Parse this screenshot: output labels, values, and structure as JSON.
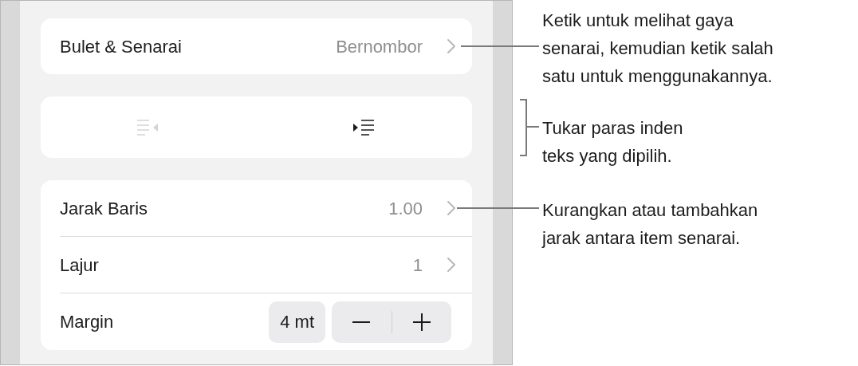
{
  "list_style_row": {
    "label": "Bulet & Senarai",
    "value": "Bernombor"
  },
  "indent_buttons": [
    {
      "kind": "outdent",
      "disabled": true
    },
    {
      "kind": "indent",
      "disabled": false
    }
  ],
  "rows": [
    {
      "kind": "disclosure",
      "label": "Jarak Baris",
      "value": "1.00"
    },
    {
      "kind": "disclosure",
      "label": "Lajur",
      "value": "1"
    },
    {
      "kind": "stepper",
      "label": "Margin",
      "value": "4 mt"
    }
  ],
  "callouts": [
    {
      "kind": "line",
      "text": "Ketik untuk melihat gaya\nsenarai, kemudian ketik salah\nsatu untuk menggunakannya."
    },
    {
      "kind": "bracket",
      "text": "Tukar paras inden\nteks yang dipilih."
    },
    {
      "kind": "line",
      "text": "Kurangkan atau tambahkan\njarak antara item senarai."
    }
  ]
}
